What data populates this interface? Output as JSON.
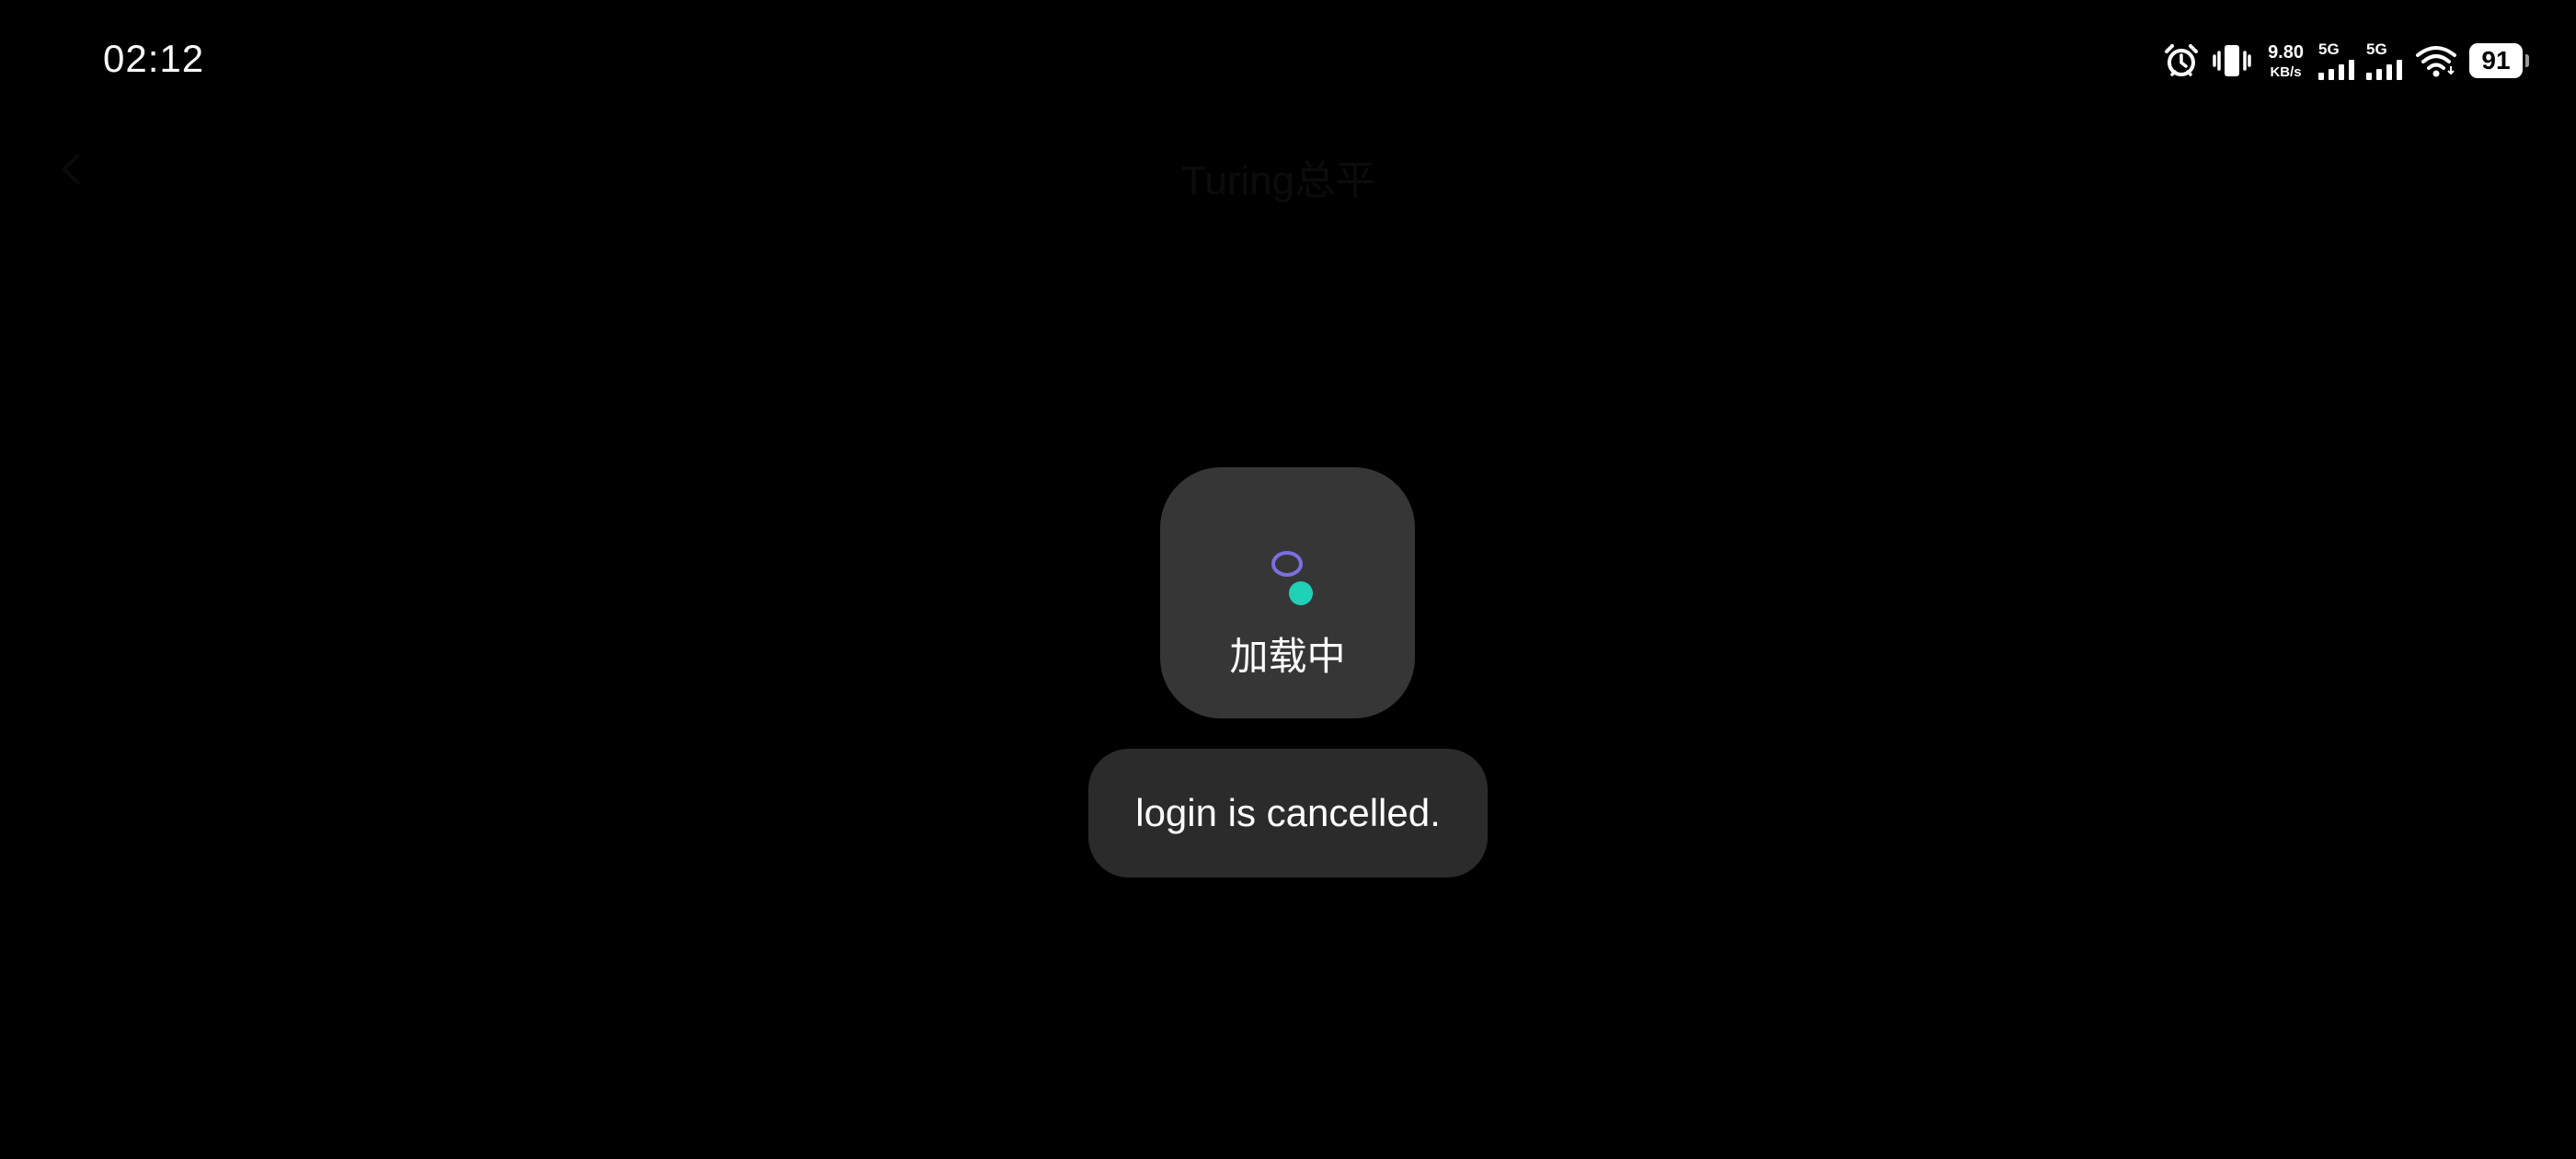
{
  "status_bar": {
    "time": "02:12",
    "net_speed_value": "9.80",
    "net_speed_unit": "KB/s",
    "sim1_tag": "5G",
    "sim2_tag": "5G",
    "battery_level": "91",
    "icons": [
      "alarm-icon",
      "vibrate-icon",
      "signal-icon",
      "wifi-icon",
      "battery-icon"
    ]
  },
  "background_page": {
    "title": "Turing总平"
  },
  "loading_dialog": {
    "label": "加载中",
    "spinner_colors": [
      "#7b6fe0",
      "#1fd1b6"
    ]
  },
  "toast": {
    "message": "login is cancelled."
  }
}
